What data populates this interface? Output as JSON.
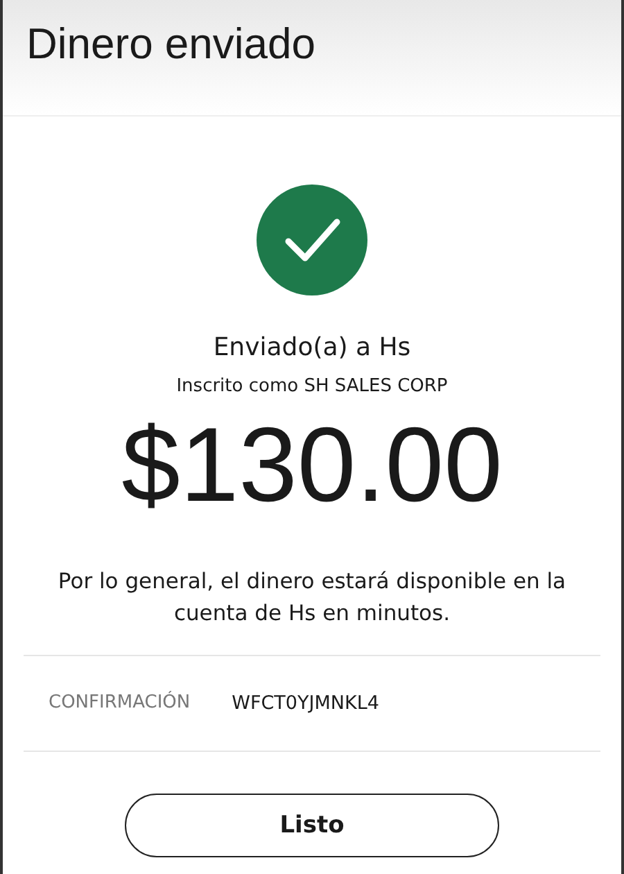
{
  "header": {
    "title": "Dinero enviado"
  },
  "status": {
    "kind": "success"
  },
  "recipient": {
    "sent_to": "Enviado(a) a Hs",
    "enrolled_as": "Inscrito como SH SALES CORP"
  },
  "amount": "$130.00",
  "message": "Por lo general, el dinero estará disponible en la cuenta de Hs en minutos.",
  "confirmation": {
    "label": "CONFIRMACIÓN",
    "value": "WFCT0YJMNKL4"
  },
  "buttons": [
    "Listo"
  ]
}
